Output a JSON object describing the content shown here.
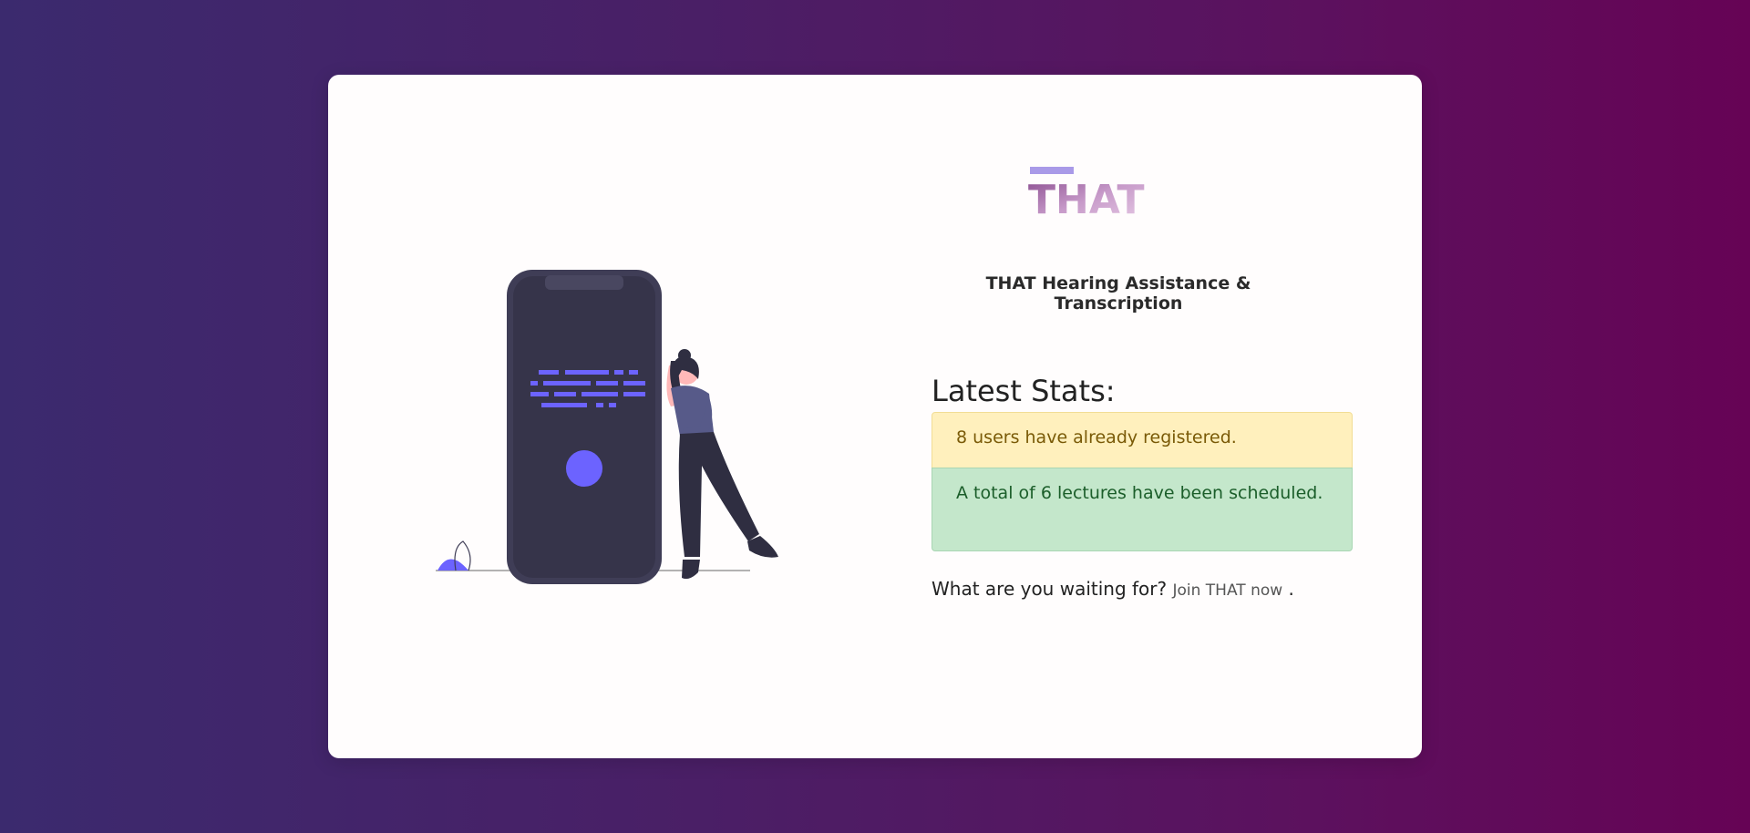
{
  "brand": {
    "logo_text": "THAT",
    "app_title": "THAT Hearing Assistance & Transcription"
  },
  "stats": {
    "heading": "Latest Stats:",
    "users_message": "8 users have already registered.",
    "lectures_message": "A total of 6 lectures have been scheduled."
  },
  "cta": {
    "prompt": "What are you waiting for?",
    "link_text": "Join THAT now",
    "suffix": "."
  },
  "colors": {
    "background_start": "#3b2a6e",
    "background_end": "#660355",
    "accent": "#6c63ff",
    "phone_body": "#3f3d56",
    "warning_bg": "#fff0bd",
    "success_bg": "#c4e7cb"
  },
  "illustration": {
    "name": "woman-leaning-on-phone-illustration"
  }
}
